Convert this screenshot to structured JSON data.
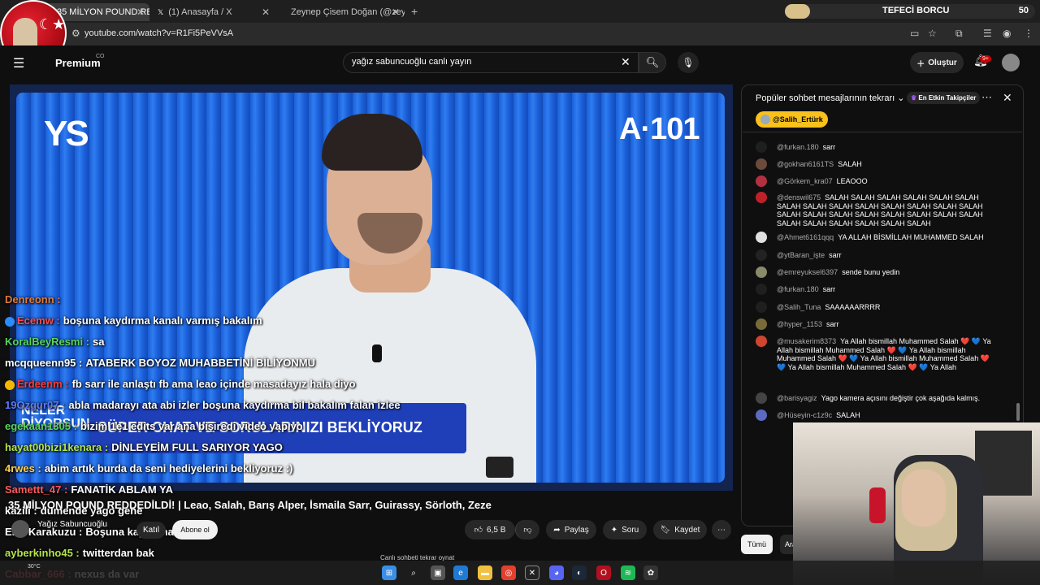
{
  "browser": {
    "tabs": [
      {
        "title": "35 MİLYON POUND REDDE",
        "favicon_color": "#ff0000"
      },
      {
        "title": "(1) Anasayfa / X",
        "favicon_color": "#ffffff"
      },
      {
        "title": "Zeynep Çisem Doğan (@zeynep",
        "favicon_color": "#e1306c"
      }
    ],
    "new_tab": "+",
    "url": "youtube.com/watch?v=R1Fi5PeVVsA",
    "extension_bar": {
      "label": "TEFECİ BORCU",
      "count": "50",
      "progress": 0.1
    }
  },
  "youtube": {
    "premium_label": "Premium",
    "premium_region": "CO",
    "search": {
      "value": "yağız sabuncuoğlu canlı yayın",
      "placeholder": "Ara"
    },
    "create_label": "Oluştur",
    "notifications_badge": "9+"
  },
  "video": {
    "brand_left": "YS",
    "brand_right": "A·101",
    "banner_text": "SÜPER CHAT VE SORULARINIZI BEKLİYORUZ",
    "banner_logo": "NELER\nDİYORSUN",
    "title": "35 MİLYON POUND REDDEDİLDİ! | Leao, Salah, Barış Alper, İsmaila Sarr, Guirassy, Sörloth, Zeze",
    "channel_name": "Yağız Sabuncuoğlu",
    "join_label": "Katıl",
    "subscribe_label": "Abone ol",
    "likes": "6,5 B",
    "share_label": "Paylaş",
    "ask_label": "Soru",
    "save_label": "Kaydet",
    "replay_label": "Canlı sohbeti tekrar oynat"
  },
  "overlay_chat": [
    {
      "user": "Denreonn",
      "msg": "",
      "color": "#e07b39",
      "badge": ""
    },
    {
      "user": "Ecemw",
      "msg": "boşuna kaydırma kanalı varmış bakalım",
      "color": "#ff4d4d",
      "badge": "#2a8cff"
    },
    {
      "user": "KoralBeyResmi",
      "msg": "sa",
      "color": "#5bd45b",
      "badge": ""
    },
    {
      "user": "mcqqueenn95",
      "msg": "ATABERK BOYOZ MUHABBETİNİ BİLİYONMU",
      "color": "#ffffff",
      "badge": ""
    },
    {
      "user": "Erdeenm",
      "msg": "fb sarr ile anlaştı fb ama leao içinde masadayız hala diyo",
      "color": "#ff3b3b",
      "badge": "#f5b800"
    },
    {
      "user": "19Ozgur07",
      "msg": "abla madarayı ata abi izler boşuna kaydırma bil bakalım falan izlee",
      "color": "#5b7bff",
      "badge": ""
    },
    {
      "user": "egekaan1305",
      "msg": "bizim 1e1 edits var ana bişiredi video yapıyo",
      "color": "#5bd45b",
      "badge": ""
    },
    {
      "user": "hayat00bizi1kenara",
      "msg": "DİNLEYEİM FULL SARIYOR YAGO",
      "color": "#b5e34a",
      "badge": ""
    },
    {
      "user": "4rwes",
      "msg": "abim artık burda da seni hediyelerini bekliyoruz :)",
      "color": "#ffd24a",
      "badge": ""
    },
    {
      "user": "Samettt_47",
      "msg": "FANATİK ABLAM YA",
      "color": "#ff5a5a",
      "badge": ""
    },
    {
      "user": "kazili",
      "msg": "dümende yago gene",
      "color": "#ffffff",
      "badge": ""
    },
    {
      "user": "EmirKarakuzu",
      "msg": "Boşuna kaydırma var",
      "color": "#ffffff",
      "badge": ""
    },
    {
      "user": "ayberkinho45",
      "msg": "twitterdan bak",
      "color": "#b5e34a",
      "badge": ""
    },
    {
      "user": "Cabbar_666",
      "msg": "nexus da var",
      "color": "#ff5a5a",
      "badge": ""
    }
  ],
  "live_chat": {
    "title": "Popüler sohbet mesajlarının tekrarı",
    "filter_chip": "En Etkin Takipçiler",
    "pinned_user": "@Salih_Ertürk",
    "messages": [
      {
        "user": "@furkan.180",
        "text": "sarr",
        "avatar": "#1f1f1f"
      },
      {
        "user": "@gokhan6161TS",
        "text": "SALAH",
        "avatar": "#6b4b3b"
      },
      {
        "user": "@Görkem_kra07",
        "text": "LEAOOO",
        "avatar": "#b33040"
      },
      {
        "user": "@denswil675",
        "text": "SALAH SALAH SALAH SALAH SALAH SALAH SALAH SALAH SALAH SALAH SALAH SALAH SALAH SALAH SALAH SALAH SALAH SALAH SALAH SALAH SALAH SALAH SALAH SALAH SALAH SALAH SALAH SALAH",
        "avatar": "#c0202a"
      },
      {
        "user": "@Ahmet6161qqq",
        "text": "YA ALLAH BİSMİLLAH MUHAMMED SALAH",
        "avatar": "#e0e0e0"
      },
      {
        "user": "@ytBaran_işte",
        "text": "sarr",
        "avatar": "#222"
      },
      {
        "user": "@emreyuksel6397",
        "text": "sende bunu yedin",
        "avatar": "#8a8a6a"
      },
      {
        "user": "@furkan.180",
        "text": "sarr",
        "avatar": "#1f1f1f"
      },
      {
        "user": "@Salih_Tuna",
        "text": "SAAAAAARRRR",
        "avatar": "#1f1f1f"
      },
      {
        "user": "@hyper_1153",
        "text": "sarr",
        "avatar": "#7a6a3a"
      },
      {
        "user": "@musakerim8373",
        "text": "Ya Allah bismillah Muhammed Salah ❤️ 💙 Ya Allah bismillah Muhammed Salah ❤️ 💙 Ya Allah bismillah Muhammed Salah ❤️ 💙 Ya Allah bismillah Muhammed Salah ❤️ 💙 Ya Allah bismillah Muhammed Salah ❤️ 💙 Ya Allah",
        "avatar": "#d0452f"
      },
      {
        "user": "@barisyagiz",
        "text": "Yago kamera açısını değiştir çok aşağıda kalmış.",
        "avatar": "#444"
      },
      {
        "user": "@Hüseyin-c1z9c",
        "text": "SALAH",
        "avatar": "#5c6bc0"
      }
    ],
    "chip_all": "Tümü",
    "chip_search": "Ara"
  },
  "taskbar": {
    "weather": "30°C"
  }
}
